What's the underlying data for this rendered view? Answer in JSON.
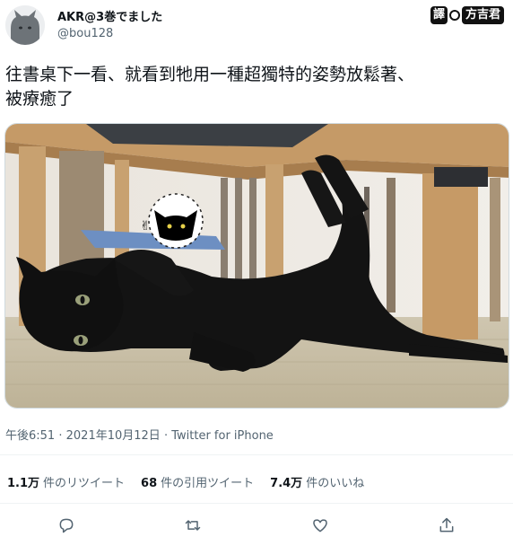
{
  "author": {
    "name": "AKR@3巻でました",
    "handle": "@bou128"
  },
  "badge": {
    "part1": "譯",
    "part2": "方吉君"
  },
  "tweet": {
    "line1": "往書桌下一看、就看到牠用一種超獨特的姿勢放鬆著、",
    "line2": "被療癒了"
  },
  "meta": {
    "time": "午後6:51",
    "date": "2021年10月12日",
    "sep": "·",
    "client": "Twitter for iPhone"
  },
  "stats": {
    "retweets_count": "1.1万",
    "retweets_label": "件のリツイート",
    "quotes_count": "68",
    "quotes_label": "件の引用ツイート",
    "likes_count": "7.4万",
    "likes_label": "件のいいね"
  },
  "icons": [
    "reply-icon",
    "retweet-icon",
    "like-icon",
    "share-icon"
  ],
  "colors": {
    "text": "#0f1419",
    "secondary": "#536471",
    "divider": "#eff3f4"
  }
}
